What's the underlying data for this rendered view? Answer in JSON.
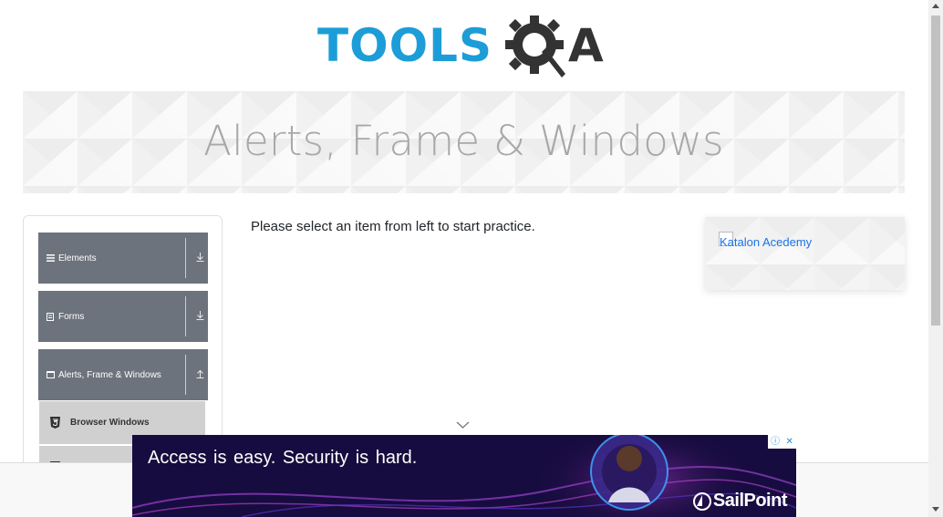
{
  "logo": {
    "part1": "TOOLS",
    "part2": "A",
    "color_primary": "#1c9dd8",
    "color_dark": "#333333"
  },
  "banner": {
    "title": "Alerts, Frame & Windows"
  },
  "sidebar": {
    "groups": [
      {
        "label": "Elements",
        "icon": "hamburger-icon",
        "state": "collapsed"
      },
      {
        "label": "Forms",
        "icon": "form-icon",
        "state": "collapsed"
      },
      {
        "label": "Alerts, Frame & Windows",
        "icon": "window-icon",
        "state": "expanded"
      }
    ],
    "items": [
      {
        "label": "Browser Windows",
        "icon": "html5-icon"
      }
    ]
  },
  "main": {
    "message": "Please select an item from left to start practice."
  },
  "right_ad": {
    "alt_text": "Katalon Acedemy"
  },
  "bottom_ad": {
    "headline": "Access is easy.  Security is hard.",
    "brand": "SailPoint",
    "bg_color": "#170c3f"
  },
  "colors": {
    "menu_header": "#6c737c",
    "menu_item": "#d0d0d0",
    "link": "#1a73e8"
  }
}
